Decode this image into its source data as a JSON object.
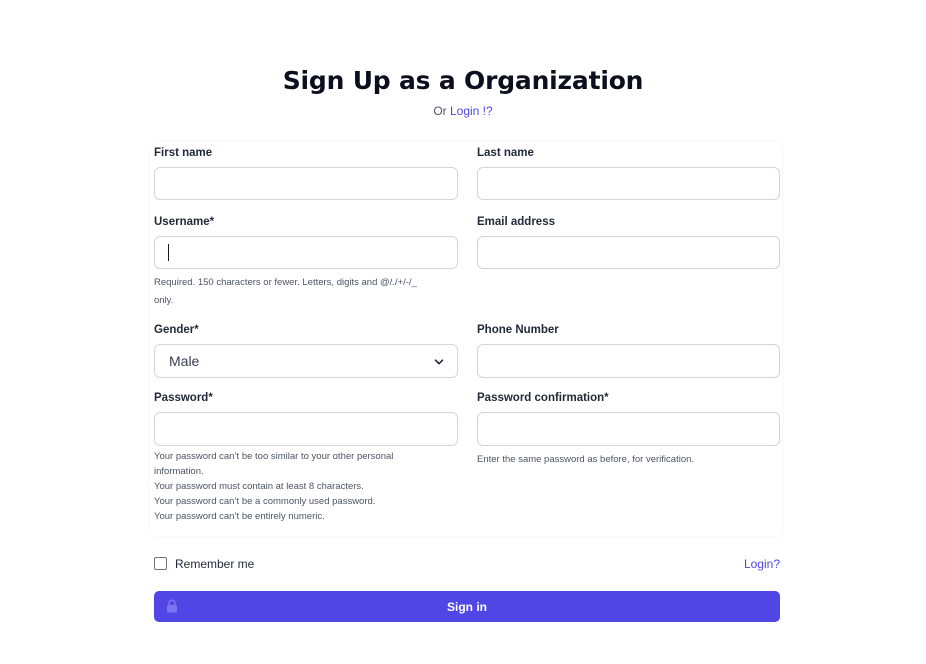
{
  "header": {
    "title": "Sign Up as a Organization",
    "subtitle_prefix": "Or ",
    "login_link": "Login !?"
  },
  "form": {
    "first_name_label": "First name",
    "last_name_label": "Last name",
    "username_label": "Username*",
    "username_help_1": "Required. 150 characters or fewer. Letters, digits and @/./+/-/_",
    "username_help_2": "only.",
    "email_label": "Email address",
    "gender_label": "Gender*",
    "gender_value": "Male",
    "phone_label": "Phone Number",
    "password_label": "Password*",
    "password_help": [
      "Your password can’t be too similar to your other personal",
      "information.",
      "Your password must contain at least 8 characters.",
      "Your password can’t be a commonly used password.",
      "Your password can’t be entirely numeric."
    ],
    "password_confirm_label": "Password confirmation*",
    "password_confirm_help": "Enter the same password as before, for verification."
  },
  "footer": {
    "remember_label": "Remember me",
    "login_link": "Login?",
    "signin_label": "Sign in"
  },
  "colors": {
    "accent": "#4f46e5",
    "border": "#d1d5db",
    "title": "#0b0f1e"
  },
  "icons": {
    "select_chevron": "chevron-down-icon",
    "button_lock": "lock-icon"
  }
}
